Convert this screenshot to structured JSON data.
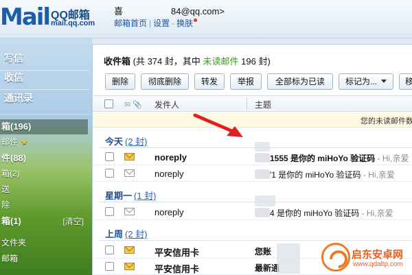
{
  "colors": {
    "link": "#1f54a0",
    "unread_green": "#35a016",
    "group_blue": "#1d4e93",
    "watermark_orange": "#e8601e"
  },
  "header": {
    "logo_mark": "Mail",
    "brand": "QQ邮箱",
    "domain": "mail.qq.com",
    "user_prefix": "喜",
    "user_email_suffix": "84@qq.com>",
    "links": [
      "邮箱首页",
      "设置",
      "换肤"
    ]
  },
  "nav": {
    "compose": "写信",
    "inbox": "收信",
    "contacts": "通讯录",
    "folders": [
      {
        "label": "箱(196)",
        "bold": true,
        "active": true
      },
      {
        "label": "邮件",
        "star": true
      },
      {
        "label": "件(88)",
        "bold": true
      },
      {
        "label": "箱(2)"
      },
      {
        "label": "送"
      },
      {
        "label": "除"
      },
      {
        "label": "箱(1)",
        "bold": true,
        "clear": "[清空]"
      },
      {
        "label": "文件夹"
      },
      {
        "label": "邮箱"
      }
    ]
  },
  "main": {
    "title": "收件箱",
    "title_count_open": "(共 374 封，其中",
    "unread_label": "未读邮件",
    "title_count_close": "196 封)",
    "toolbar": {
      "delete": "删除",
      "delete_permanent": "彻底删除",
      "forward": "转发",
      "report": "举报",
      "mark_all_read": "全部标为已读",
      "mark_as": "标记为...",
      "move": "移动"
    },
    "columns": {
      "sender": "发件人",
      "subject": "主题"
    },
    "notice": "您的未读邮件数"
  },
  "groups": [
    {
      "label": "今天",
      "count": "(2 封)",
      "rows": [
        {
          "from": "noreply",
          "subject": "1555 是你的 miHoYo 验证码",
          "preview": " - Hi,亲爱",
          "unread": true
        },
        {
          "from": "noreply",
          "subject": "'1 是你的 miHoYo 验证码",
          "preview": " - Hi,亲爱",
          "unread": false
        }
      ]
    },
    {
      "label": "星期一",
      "count": "(1 封)",
      "rows": [
        {
          "from": "noreply",
          "subject": "4 是你的 miHoYo 验证码",
          "preview": " - Hi,亲爱",
          "unread": false
        }
      ]
    },
    {
      "label": "上周",
      "count": "(2 封)",
      "rows": [
        {
          "from": "平安信用卡",
          "subject": "您账",
          "preview": "",
          "unread": true
        },
        {
          "from": "平安信用卡",
          "subject": "最新通",
          "preview": "",
          "unread": true
        }
      ]
    }
  ],
  "watermark": {
    "title": "启东安卓网",
    "url": "www.qdaltp.com"
  }
}
